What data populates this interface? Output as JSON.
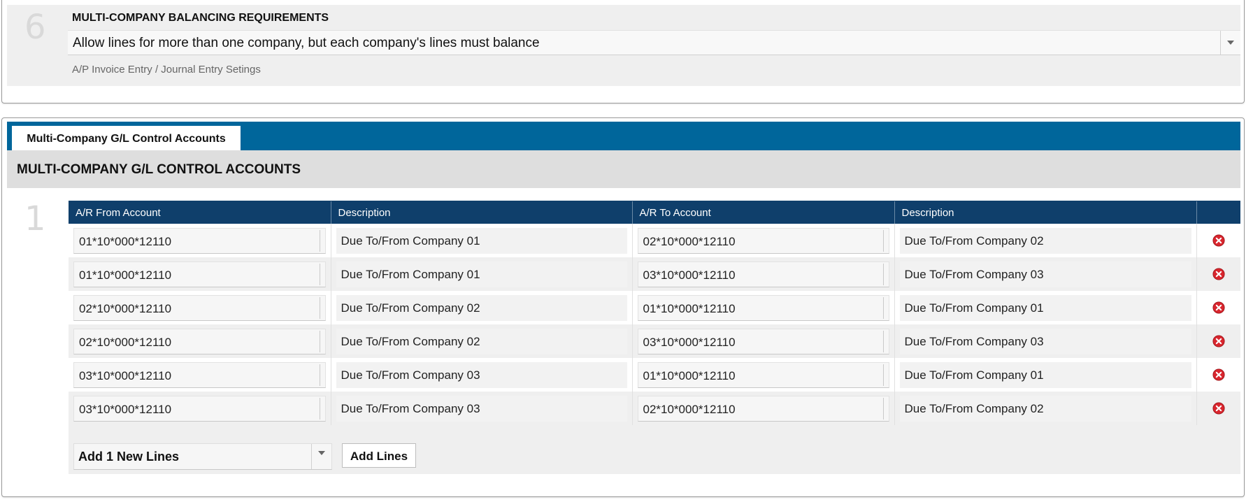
{
  "section6": {
    "step_number": "6",
    "title": "MULTI-COMPANY BALANCING REQUIREMENTS",
    "selected_value": "Allow lines for more than one company, but each company's lines must balance",
    "hint": "A/P Invoice Entry / Journal Entry Setings"
  },
  "section1": {
    "tab_label": "Multi-Company G/L Control Accounts",
    "header": "MULTI-COMPANY G/L CONTROL ACCOUNTS",
    "step_number": "1",
    "columns": [
      "A/R From Account",
      "Description",
      "A/R To Account",
      "Description",
      ""
    ],
    "rows": [
      {
        "from_account": "01*10*000*12110",
        "from_desc": "Due To/From Company 01",
        "to_account": "02*10*000*12110",
        "to_desc": "Due To/From Company 02"
      },
      {
        "from_account": "01*10*000*12110",
        "from_desc": "Due To/From Company 01",
        "to_account": "03*10*000*12110",
        "to_desc": "Due To/From Company 03"
      },
      {
        "from_account": "02*10*000*12110",
        "from_desc": "Due To/From Company 02",
        "to_account": "01*10*000*12110",
        "to_desc": "Due To/From Company 01"
      },
      {
        "from_account": "02*10*000*12110",
        "from_desc": "Due To/From Company 02",
        "to_account": "03*10*000*12110",
        "to_desc": "Due To/From Company 03"
      },
      {
        "from_account": "03*10*000*12110",
        "from_desc": "Due To/From Company 03",
        "to_account": "01*10*000*12110",
        "to_desc": "Due To/From Company 01"
      },
      {
        "from_account": "03*10*000*12110",
        "from_desc": "Due To/From Company 03",
        "to_account": "02*10*000*12110",
        "to_desc": "Due To/From Company 02"
      }
    ],
    "row_action_icon": "delete-circle-icon",
    "add_lines_select": "Add 1 New Lines",
    "add_lines_button": "Add Lines"
  },
  "colors": {
    "tab_bar": "#00669b",
    "grid_header": "#0f3f6b",
    "delete_icon": "#d9262e"
  }
}
